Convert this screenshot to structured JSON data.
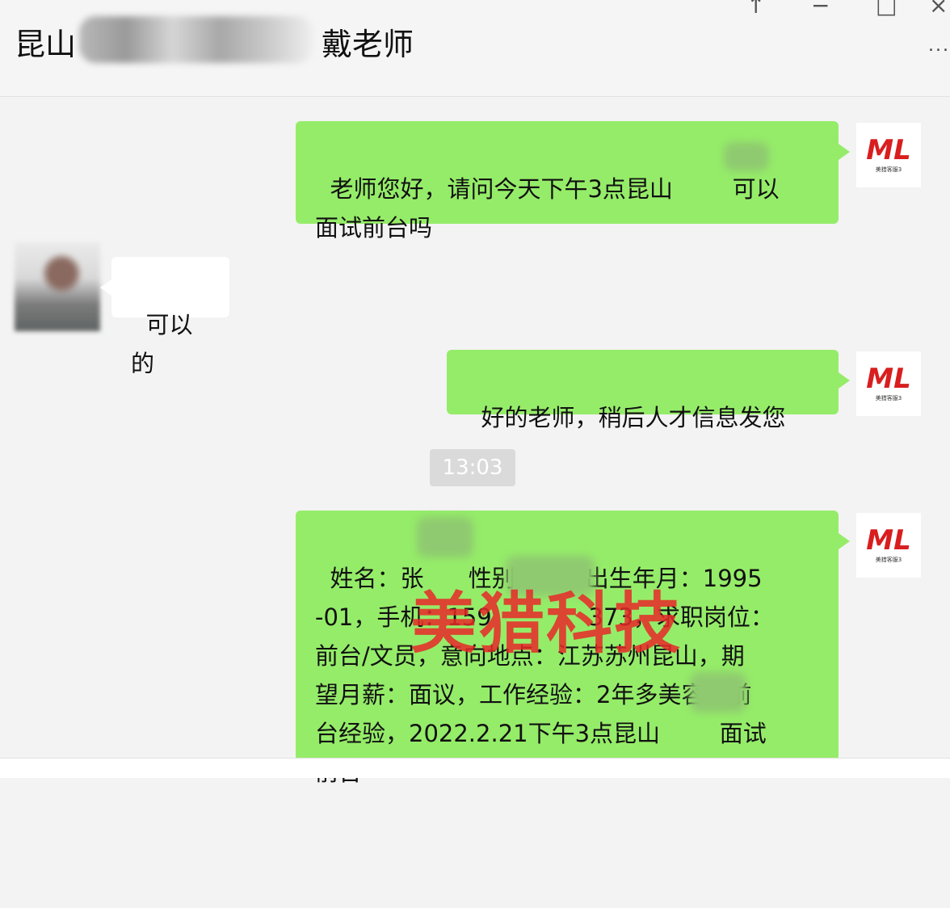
{
  "header": {
    "title_prefix": "昆山",
    "title_suffix": "戴老师",
    "pin_icon": "↑",
    "minimize_icon": "−",
    "maximize_icon": "□",
    "close_icon": "×",
    "more_label": "..."
  },
  "messages": [
    {
      "text": "老师您好，请问今天下午3点昆山        可以\n面试前台吗"
    },
    {
      "text": "可以的"
    },
    {
      "text": "好的老师，稍后人才信息发您"
    },
    {
      "text": "姓名：张      性别：女，出生年月：1995\n-01，手机：159             373，求职岗位：\n前台/文员，意向地点：江苏苏州昆山，期\n望月薪：面议，工作经验：2年多美容院前\n台经验，2022.2.21下午3点昆山        面试\n前台"
    }
  ],
  "timestamp": "13:03",
  "avatar": {
    "logo_text": "ML",
    "logo_sub": "美猎客服3"
  },
  "watermark": "美猎科技",
  "colors": {
    "bubble_self": "#95ec69",
    "bubble_other": "#ffffff",
    "background": "#f3f3f3",
    "watermark": "#e82828"
  }
}
